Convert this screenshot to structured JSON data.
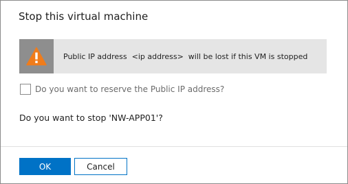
{
  "dialog": {
    "title": "Stop this virtual machine",
    "warning": {
      "icon": "warning-triangle-icon",
      "text": "Public IP address  <ip address>  will be lost if this VM is stopped"
    },
    "reserve_checkbox": {
      "label": "Do you want to reserve the Public IP address?",
      "checked": false
    },
    "question": "Do you want to stop 'NW-APP01'?",
    "buttons": {
      "ok_label": "OK",
      "cancel_label": "Cancel"
    }
  },
  "colors": {
    "primary": "#0072c6",
    "warning_orange": "#f07c1b",
    "warning_icon_bg": "#8e8e8e",
    "warning_bg": "#e5e5e5"
  }
}
